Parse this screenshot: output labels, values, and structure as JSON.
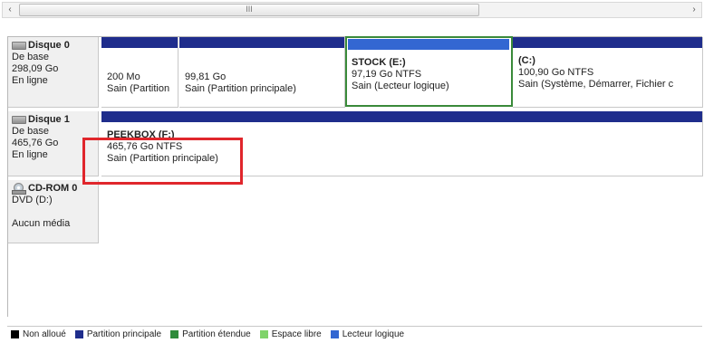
{
  "scrollbar": {
    "left_arrow": "‹",
    "right_arrow": "›",
    "thumb_grip": "III"
  },
  "disks": [
    {
      "name": "Disque 0",
      "type": "De base",
      "size": "298,09 Go",
      "status": "En ligne",
      "icon": "hard-disk-icon",
      "partitions": [
        {
          "name": "",
          "size": "200 Mo",
          "status": "Sain (Partition",
          "bar": "primary"
        },
        {
          "name": "",
          "size": "99,81 Go",
          "status": "Sain (Partition principale)",
          "bar": "primary"
        },
        {
          "name": "STOCK  (E:)",
          "size": "97,19 Go NTFS",
          "status": "Sain (Lecteur logique)",
          "bar": "logical"
        },
        {
          "name": "(C:)",
          "size": "100,90 Go NTFS",
          "status": "Sain (Système, Démarrer, Fichier c",
          "bar": "primary"
        }
      ]
    },
    {
      "name": "Disque 1",
      "type": "De base",
      "size": "465,76 Go",
      "status": "En ligne",
      "icon": "hard-disk-icon",
      "partitions": [
        {
          "name": "PEEKBOX  (F:)",
          "size": "465,76 Go NTFS",
          "status": "Sain (Partition principale)",
          "bar": "primary"
        }
      ]
    },
    {
      "name": "CD-ROM 0",
      "type": "DVD (D:)",
      "size": "",
      "status": "Aucun média",
      "icon": "cd-rom-icon",
      "partitions": []
    }
  ],
  "legend": [
    {
      "label": "Non alloué",
      "color": "#000000"
    },
    {
      "label": "Partition principale",
      "color": "#1f2d8c"
    },
    {
      "label": "Partition étendue",
      "color": "#2e8b3a"
    },
    {
      "label": "Espace libre",
      "color": "#7fd36a"
    },
    {
      "label": "Lecteur logique",
      "color": "#3367d2"
    }
  ],
  "colors": {
    "primary_bar": "#1f2d8c",
    "logical_bar": "#3367d2",
    "selection_outline": "#3a8a3a",
    "highlight_box": "#e0262c"
  }
}
